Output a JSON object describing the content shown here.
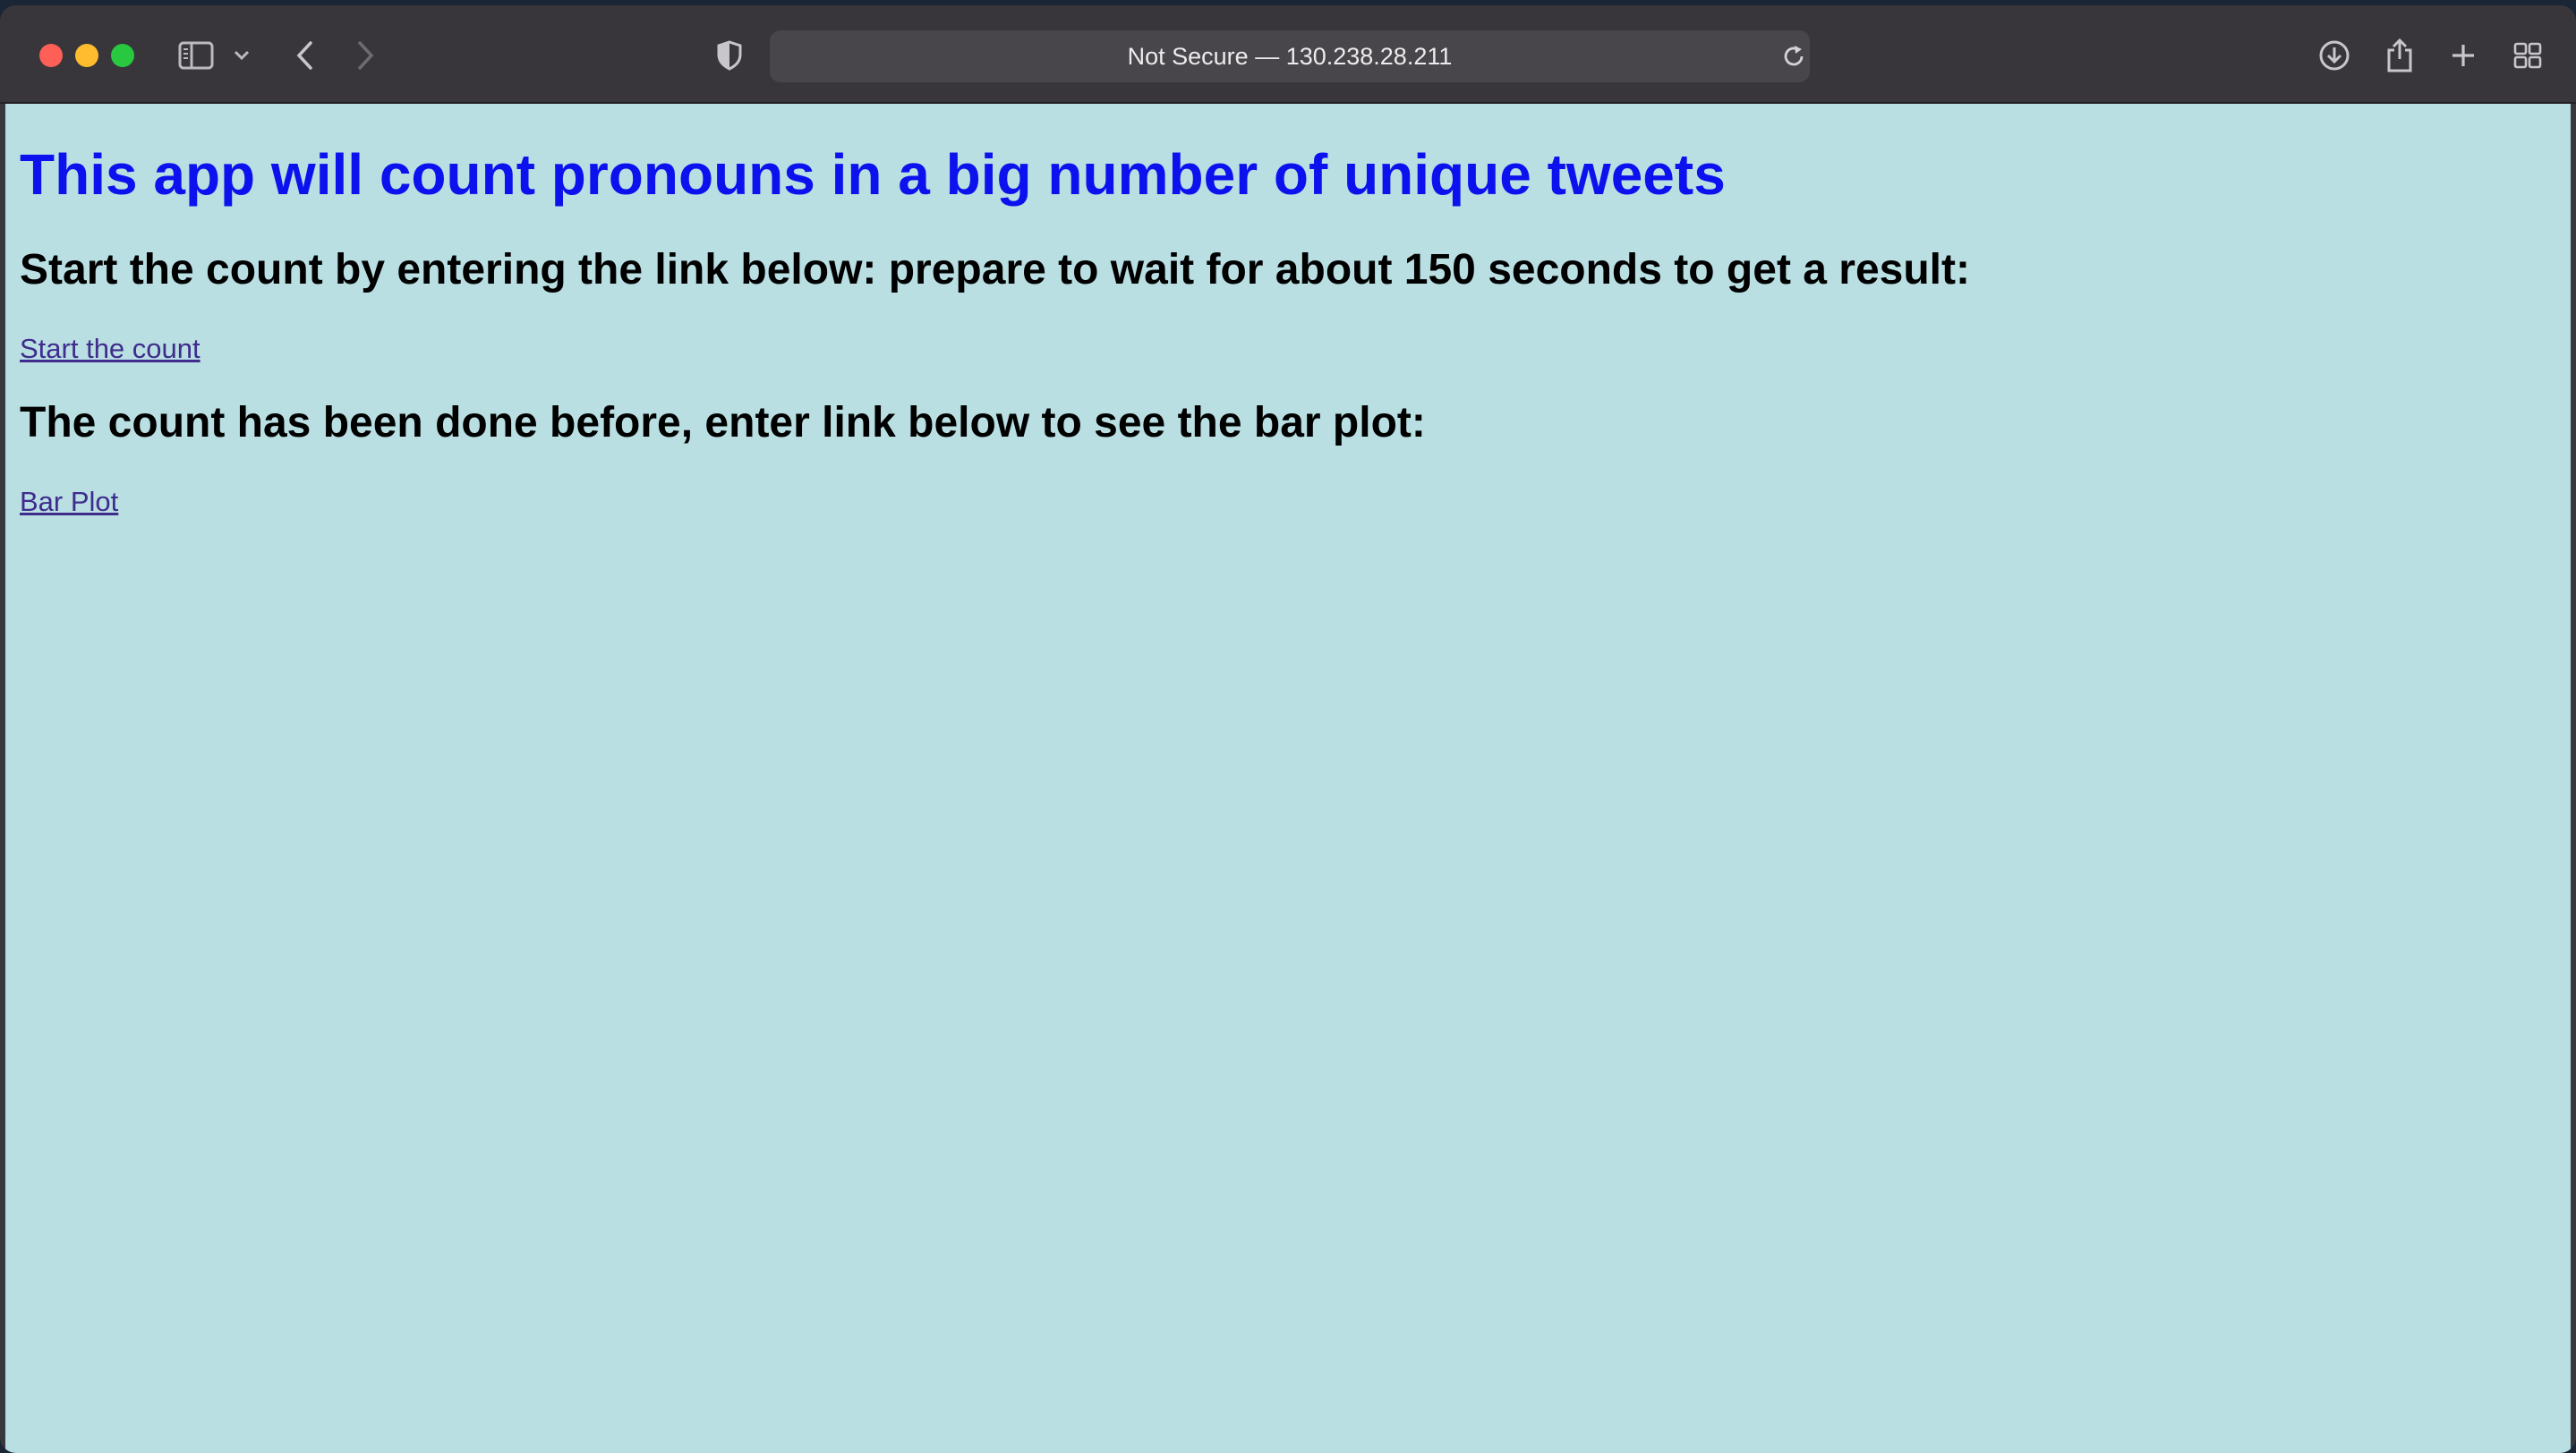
{
  "browser": {
    "address_text": "Not Secure — 130.238.28.211",
    "icons": [
      "sidebar-icon",
      "chevron-down-icon",
      "back-icon",
      "forward-icon",
      "shield-icon",
      "reload-icon",
      "download-icon",
      "share-icon",
      "plus-icon",
      "tab-grid-icon"
    ]
  },
  "page": {
    "background": "#b9dfe3",
    "title": "This app will count pronouns in a big number of unique tweets",
    "title_color": "#0b12ee",
    "start_heading": "Start the count by entering the link below: prepare to wait for about 150 seconds to get a result:",
    "start_link": "Start the count",
    "plot_heading": "The count has been done before, enter link below to see the bar plot:",
    "plot_link": "Bar Plot",
    "link_color": "#3f2c8c"
  }
}
